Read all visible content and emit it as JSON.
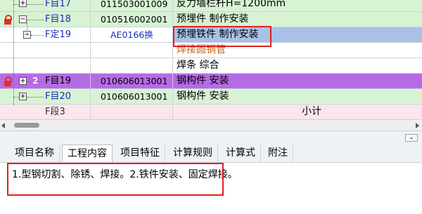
{
  "grid": {
    "rows": [
      {
        "name": "F目17",
        "code": "011503001009",
        "desc": "反力墙栏杆H=1200mm"
      },
      {
        "name": "F目18",
        "code": "010516002001",
        "desc": "预埋件 制作安装"
      },
      {
        "name": "F定19",
        "code": "AE0166换",
        "desc": "预埋铁件 制作安装"
      },
      {
        "name": "",
        "code": "",
        "desc": "焊接圆钢管"
      },
      {
        "name": "",
        "code": "",
        "desc": "焊条 综合"
      },
      {
        "name": "F目19",
        "code": "010606013001",
        "desc": "钢构件 安装"
      },
      {
        "name": "F目20",
        "code": "010606013001",
        "desc": "钢构件 安装"
      },
      {
        "name": "F段3",
        "code": "",
        "desc": "小计"
      }
    ],
    "badge": "2"
  },
  "tabs": [
    "项目名称",
    "工程内容",
    "项目特征",
    "计算规则",
    "计算式",
    "附注"
  ],
  "active_tab": "工程内容",
  "content": {
    "text": "1.型钢切割、除锈、焊接。2.铁件安装、固定焊接。"
  },
  "colors": {
    "green_row": "#d8f2d4",
    "purple_row": "#b66be6",
    "selected_cell": "#a9c1e6",
    "highlight_box": "#e02020"
  }
}
